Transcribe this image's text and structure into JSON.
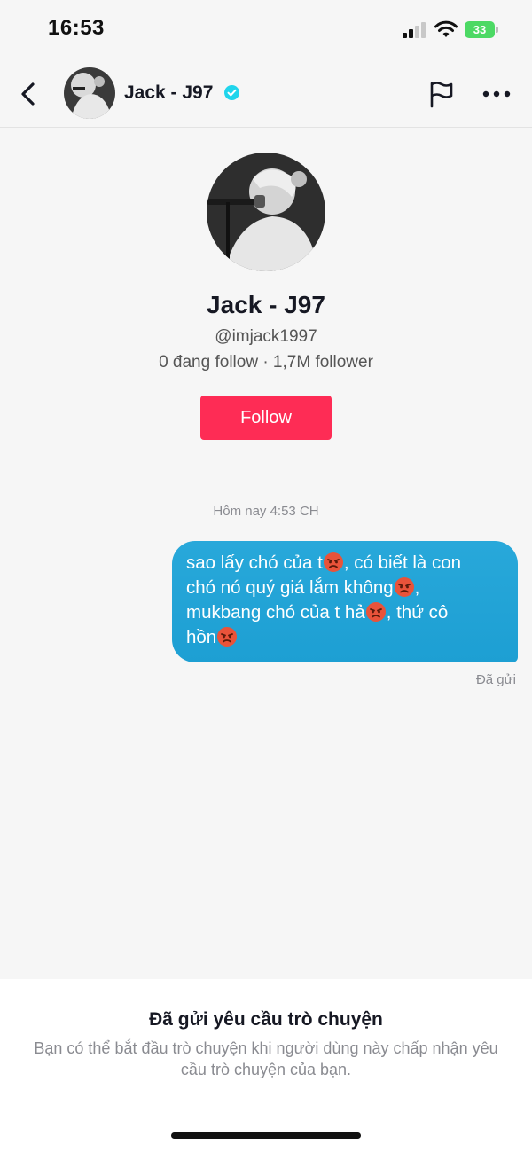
{
  "status_bar": {
    "time": "16:53",
    "battery": "33",
    "icons": [
      "signal-icon",
      "wifi-icon",
      "battery-icon"
    ]
  },
  "header": {
    "name": "Jack - J97",
    "icons": [
      "back-arrow-icon",
      "verified-badge-icon",
      "flag-icon",
      "more-dots-icon"
    ]
  },
  "profile": {
    "name": "Jack - J97",
    "handle": "@imjack1997",
    "stats": "0 đang follow · 1,7M follower",
    "follow_label": "Follow"
  },
  "chat": {
    "timestamp": "Hôm nay 4:53 CH",
    "message": {
      "line1_a": "sao lấy chó của t",
      "line1_b": ", có biết là con",
      "line2_a": "chó nó quý giá lắm không",
      "line2_b": ",",
      "line3_a": "mukbang chó của t hả",
      "line3_b": ", thứ cô",
      "line4_a": "hồn",
      "emoji": "angry-face-emoji"
    },
    "sent_status": "Đã gửi"
  },
  "bottom_sheet": {
    "title": "Đã gửi yêu cầu trò chuyện",
    "description": "Bạn có thể bắt đầu trò chuyện khi người dùng này chấp nhận yêu cầu trò chuyện của bạn."
  },
  "colors": {
    "accent": "#fe2c55",
    "bubble": "#1d9fd3",
    "verified": "#20d5ec",
    "battery": "#4cd964"
  }
}
